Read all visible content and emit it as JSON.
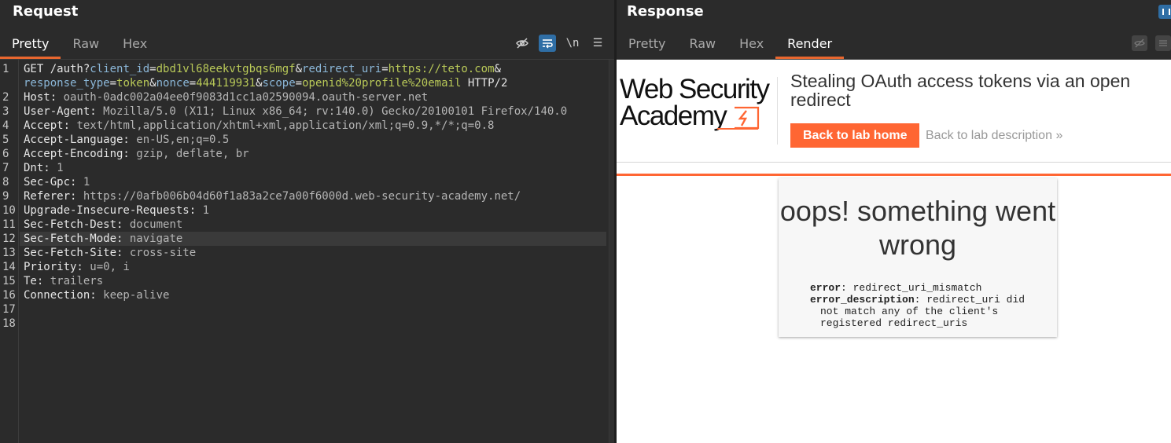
{
  "request": {
    "title": "Request",
    "tabs": [
      "Pretty",
      "Raw",
      "Hex"
    ],
    "active_tab": "Pretty",
    "toolbar": {
      "newline_toggle": "\\n",
      "menu": "☰"
    },
    "lines": [
      {
        "n": "1",
        "method": "GET /auth?",
        "p1n": "client_id",
        "p1v": "dbd1vl68eekvtgbqs6mgf",
        "p2n": "redirect_uri",
        "p2v": "https://teto.com",
        "amp": "&"
      },
      {
        "n": "",
        "p3n": "response_type",
        "p3v": "token",
        "p4n": "nonce",
        "p4v": "444119931",
        "p5n": "scope",
        "p5v": "openid%20profile%20email",
        "proto": " HTTP/2"
      },
      {
        "n": "2",
        "key": "Host:",
        "val": " oauth-0adc002a04ee0f9083d1cc1a02590094.oauth-server.net"
      },
      {
        "n": "3",
        "key": "User-Agent:",
        "val": " Mozilla/5.0 (X11; Linux x86_64; rv:140.0) Gecko/20100101 Firefox/140.0"
      },
      {
        "n": "4",
        "key": "Accept:",
        "val": " text/html,application/xhtml+xml,application/xml;q=0.9,*/*;q=0.8"
      },
      {
        "n": "5",
        "key": "Accept-Language:",
        "val": " en-US,en;q=0.5"
      },
      {
        "n": "6",
        "key": "Accept-Encoding:",
        "val": " gzip, deflate, br"
      },
      {
        "n": "7",
        "key": "Dnt:",
        "val": " 1"
      },
      {
        "n": "8",
        "key": "Sec-Gpc:",
        "val": " 1"
      },
      {
        "n": "9",
        "key": "Referer:",
        "val": " https://0afb006b04d60f1a83a2ce7a00f6000d.web-security-academy.net/"
      },
      {
        "n": "10",
        "key": "Upgrade-Insecure-Requests:",
        "val": " 1"
      },
      {
        "n": "11",
        "key": "Sec-Fetch-Dest:",
        "val": " document"
      },
      {
        "n": "12",
        "key": "Sec-Fetch-Mode:",
        "val": " navigate"
      },
      {
        "n": "13",
        "key": "Sec-Fetch-Site:",
        "val": " cross-site"
      },
      {
        "n": "14",
        "key": "Priority:",
        "val": " u=0, i"
      },
      {
        "n": "15",
        "key": "Te:",
        "val": " trailers"
      },
      {
        "n": "16",
        "key": "Connection:",
        "val": " keep-alive"
      },
      {
        "n": "17"
      },
      {
        "n": "18"
      }
    ]
  },
  "response": {
    "title": "Response",
    "tabs": [
      "Pretty",
      "Raw",
      "Hex",
      "Render"
    ],
    "active_tab": "Render",
    "render": {
      "logo_line1": "Web Security",
      "logo_line2": "Academy",
      "lab_title": "Stealing OAuth access tokens via an open redirect",
      "back_home": "Back to lab home",
      "back_desc": "Back to lab description",
      "back_desc_chevron": "»",
      "error_title": "oops! something went wrong",
      "error_key": "error",
      "error_val": ": redirect_uri_mismatch",
      "error_desc_key": "error_description",
      "error_desc_val": ": redirect_uri did",
      "error_desc_cont1": "not match any of the client's",
      "error_desc_cont2": "registered redirect_uris"
    }
  },
  "colors": {
    "accent_orange": "#e8672f",
    "wsa_orange": "#ff6633",
    "toggle_blue": "#2f6ea5",
    "param_value": "#b9c958",
    "param_name": "#8bb7d8"
  }
}
